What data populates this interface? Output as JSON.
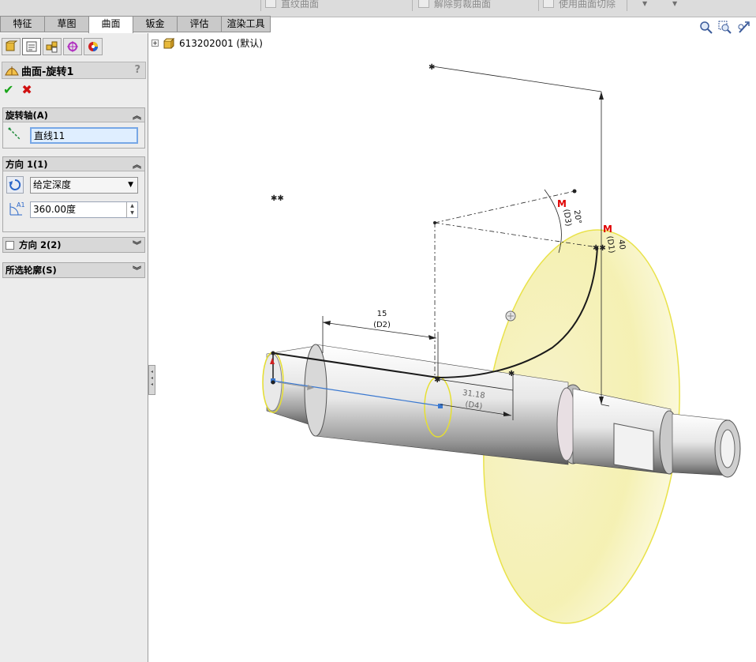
{
  "toolbar": {
    "items": [
      {
        "label": "直纹曲面",
        "icon": "ruled-surface-icon"
      },
      {
        "label": "解除剪裁曲面",
        "icon": "untrim-surface-icon"
      },
      {
        "label": "使用曲面切除",
        "icon": "cut-with-surface-icon"
      }
    ]
  },
  "tabs": [
    "特征",
    "草图",
    "曲面",
    "钣金",
    "评估",
    "渲染工具"
  ],
  "active_tab": "曲面",
  "property_manager": {
    "title": "曲面-旋转1",
    "help": "?",
    "ok": "✔",
    "cancel": "✖",
    "axis_group": {
      "title": "旋转轴(A)",
      "axis_value": "直线11"
    },
    "direction1_group": {
      "title": "方向 1(1)",
      "end_condition": "给定深度",
      "angle_value": "360.00度",
      "angle_icon_label": "A1"
    },
    "direction2_group": {
      "title": "方向 2(2)"
    },
    "contours_group": {
      "title": "所选轮廓(S)"
    }
  },
  "tree": {
    "root_label": "613202001  (默认)"
  },
  "viewport": {
    "dim_d2_value": "15",
    "dim_d2_name": "(D2)",
    "dim_d4_value": "31.18",
    "dim_d4_name": "(D4)",
    "dim_d3_value": "20°",
    "dim_d3_name": "(D3)",
    "dim_d1_value": "40",
    "dim_d1_name": "(D1)",
    "marker_m": "M"
  },
  "colors": {
    "surface_yellow": "#f6f2b8",
    "surface_edge": "#e6de3a",
    "dimension_red": "#e00000",
    "axis_blue": "#3a78d0"
  }
}
